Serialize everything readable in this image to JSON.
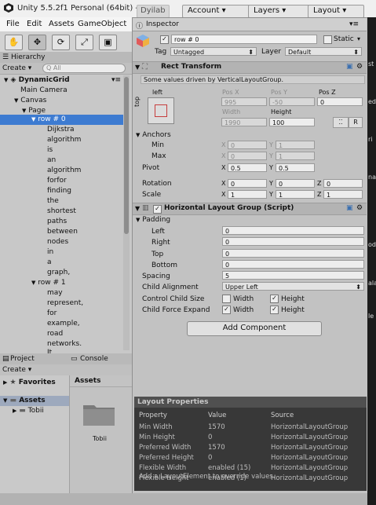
{
  "window": {
    "title": "Unity 5.5.2f1 Personal (64bit) - Dy"
  },
  "menu": [
    "File",
    "Edit",
    "Assets",
    "GameObject"
  ],
  "toolbar": {
    "layout_prefix": "Dyilab",
    "account": "Account",
    "layers": "Layers",
    "layout": "Layout"
  },
  "hierarchy": {
    "tab": "Hierarchy",
    "create": "Create",
    "search_placeholder": "Q All",
    "scene": "DynamicGrid",
    "items": [
      "Main Camera",
      "Canvas",
      "Page",
      "row # 0",
      "Dijkstra",
      "algorithm",
      "is",
      "an",
      "algorithm",
      "forfor",
      "finding",
      "the",
      "shortest",
      "paths",
      "between",
      "nodes",
      "in",
      "a",
      "graph,",
      "row # 1",
      "may",
      "represent,",
      "for",
      "example,",
      "road",
      "networks.",
      "It"
    ]
  },
  "project": {
    "tab": "Project",
    "console_tab": "Console",
    "create": "Create",
    "favorites": "Favorites",
    "assets_label": "Assets",
    "tree_assets": "Assets",
    "tree_tobii": "Tobii",
    "folder_name": "Tobii"
  },
  "inspector": {
    "tab": "Inspector",
    "object_name": "row # 0",
    "static_label": "Static",
    "tag_label": "Tag",
    "tag_value": "Untagged",
    "layer_label": "Layer",
    "layer_value": "Default",
    "rect": {
      "title": "Rect Transform",
      "note": "Some values driven by VerticalLayoutGroup.",
      "anchor_left": "left",
      "anchor_top": "top",
      "posx_label": "Pos X",
      "posx": "995",
      "posy_label": "Pos Y",
      "posy": "-50",
      "posz_label": "Pos Z",
      "posz": "0",
      "width_label": "Width",
      "width": "1990",
      "height_label": "Height",
      "height": "100",
      "reset": "R",
      "anchors": "Anchors",
      "min": "Min",
      "min_x": "0",
      "min_y": "1",
      "max": "Max",
      "max_x": "0",
      "max_y": "1",
      "pivot": "Pivot",
      "pivot_x": "0.5",
      "pivot_y": "0.5",
      "rotation": "Rotation",
      "rot_x": "0",
      "rot_y": "0",
      "rot_z": "0",
      "scale": "Scale",
      "scale_x": "1",
      "scale_y": "1",
      "scale_z": "1",
      "x": "X",
      "y": "Y",
      "z": "Z"
    },
    "hlg": {
      "title": "Horizontal Layout Group (Script)",
      "padding": "Padding",
      "left": "Left",
      "left_v": "0",
      "right": "Right",
      "right_v": "0",
      "top": "Top",
      "top_v": "0",
      "bottom": "Bottom",
      "bottom_v": "0",
      "spacing": "Spacing",
      "spacing_v": "5",
      "child_alignment": "Child Alignment",
      "child_alignment_v": "Upper Left",
      "control_child_size": "Control Child Size",
      "child_force_expand": "Child Force Expand",
      "width": "Width",
      "height": "Height"
    },
    "add_component": "Add Component",
    "layout_properties": {
      "title": "Layout Properties",
      "headers": [
        "Property",
        "Value",
        "Source"
      ],
      "rows": [
        [
          "Min Width",
          "1570",
          "HorizontalLayoutGroup"
        ],
        [
          "Min Height",
          "0",
          "HorizontalLayoutGroup"
        ],
        [
          "Preferred Width",
          "1570",
          "HorizontalLayoutGroup"
        ],
        [
          "Preferred Height",
          "0",
          "HorizontalLayoutGroup"
        ],
        [
          "Flexible Width",
          "enabled (15)",
          "HorizontalLayoutGroup"
        ],
        [
          "Flexible Height",
          "enabled (1)",
          "HorizontalLayoutGroup"
        ]
      ],
      "footer": "Add a LayoutElement to override values."
    }
  },
  "right_strip": [
    "st",
    "ed",
    "ri",
    "na",
    "od",
    "ala",
    "le"
  ]
}
